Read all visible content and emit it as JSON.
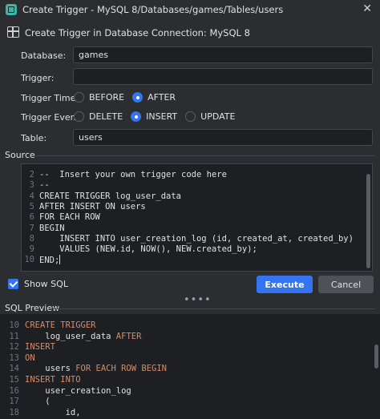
{
  "window": {
    "title": "Create Trigger - MySQL 8/Databases/games/Tables/users",
    "close_glyph": "✕"
  },
  "connection": {
    "text": "Create Trigger in Database Connection: MySQL 8"
  },
  "form": {
    "database_label": "Database:",
    "database_value": "games",
    "trigger_label": "Trigger:",
    "trigger_value": "",
    "trigger_time_label": "Trigger Time:",
    "trigger_time_options": [
      "BEFORE",
      "AFTER"
    ],
    "trigger_time_selected": "AFTER",
    "trigger_event_label": "Trigger Event:",
    "trigger_event_options": [
      "DELETE",
      "INSERT",
      "UPDATE"
    ],
    "trigger_event_selected": "INSERT",
    "table_label": "Table:",
    "table_value": "users"
  },
  "source": {
    "section_title": "Source",
    "lines": [
      {
        "n": "2",
        "text": "--  Insert your own trigger code here"
      },
      {
        "n": "3",
        "text": "--"
      },
      {
        "n": "4",
        "text": "CREATE TRIGGER log_user_data"
      },
      {
        "n": "5",
        "text": "AFTER INSERT ON users"
      },
      {
        "n": "6",
        "text": "FOR EACH ROW"
      },
      {
        "n": "7",
        "text": "BEGIN"
      },
      {
        "n": "8",
        "text": "    INSERT INTO user_creation_log (id, created_at, created_by)"
      },
      {
        "n": "9",
        "text": "    VALUES (NEW.id, NOW(), NEW.created_by);"
      },
      {
        "n": "10",
        "text": "END;"
      }
    ]
  },
  "footer": {
    "show_sql_label": "Show SQL",
    "show_sql_checked": true,
    "execute_label": "Execute",
    "cancel_label": "Cancel",
    "splitter_glyph": "••••"
  },
  "preview": {
    "section_title": "SQL Preview",
    "lines": [
      {
        "n": "10",
        "parts": [
          {
            "t": "CREATE TRIGGER",
            "kw": true
          }
        ]
      },
      {
        "n": "11",
        "parts": [
          {
            "t": "    log_user_data ",
            "kw": false
          },
          {
            "t": "AFTER",
            "kw": true
          }
        ]
      },
      {
        "n": "12",
        "parts": [
          {
            "t": "INSERT",
            "kw": true
          }
        ]
      },
      {
        "n": "13",
        "parts": [
          {
            "t": "ON",
            "kw": true
          }
        ]
      },
      {
        "n": "14",
        "parts": [
          {
            "t": "    users ",
            "kw": false
          },
          {
            "t": "FOR EACH ROW BEGIN",
            "kw": true
          }
        ]
      },
      {
        "n": "15",
        "parts": [
          {
            "t": "INSERT INTO",
            "kw": true
          }
        ]
      },
      {
        "n": "16",
        "parts": [
          {
            "t": "    user_creation_log",
            "kw": false
          }
        ]
      },
      {
        "n": "17",
        "parts": [
          {
            "t": "    (",
            "kw": false
          }
        ]
      },
      {
        "n": "18",
        "parts": [
          {
            "t": "        id,",
            "kw": false
          }
        ]
      }
    ]
  },
  "colors": {
    "accent": "#3574f0",
    "keyword": "#cf8e6d",
    "background": "#2b2d30",
    "editor_background": "#1e1f22"
  },
  "icons": {
    "app": "datagrip-app-icon",
    "connection": "table-icon"
  }
}
